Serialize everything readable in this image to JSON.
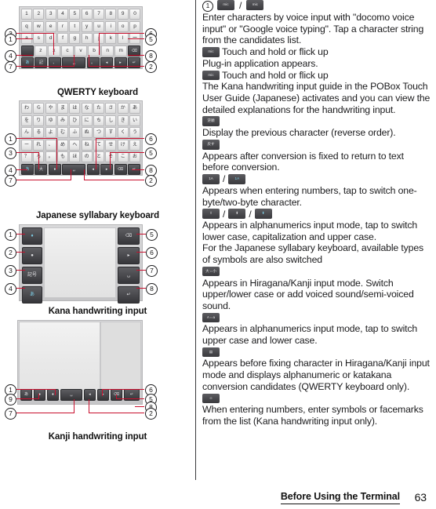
{
  "document": {
    "footer_section": "Before Using the Terminal",
    "page_number": "63"
  },
  "figures": [
    {
      "id": "qwerty-keyboard",
      "caption": "QWERTY keyboard",
      "callouts": [
        "3",
        "1",
        "4",
        "7",
        "6",
        "5",
        "8",
        "2"
      ],
      "rows": [
        [
          "1",
          "2",
          "3",
          "4",
          "5",
          "6",
          "7",
          "8",
          "9",
          "0"
        ],
        [
          "q",
          "w",
          "e",
          "r",
          "t",
          "y",
          "u",
          "i",
          "o",
          "p"
        ],
        [
          "a",
          "s",
          "d",
          "f",
          "g",
          "h",
          "j",
          "k",
          "l",
          "ー"
        ],
        [
          "",
          "z",
          "x",
          "c",
          "v",
          "b",
          "n",
          "m",
          "",
          ""
        ],
        [
          "",
          "",
          "",
          "",
          "",
          "",
          "",
          ""
        ]
      ]
    },
    {
      "id": "japanese-syllabary-keyboard",
      "caption": "Japanese syllabary keyboard",
      "callouts": [
        "1",
        "3",
        "4",
        "7",
        "6",
        "5",
        "8",
        "2"
      ],
      "rows": [
        [
          "わ",
          "ら",
          "や",
          "ま",
          "は",
          "な",
          "た",
          "さ",
          "か",
          "あ"
        ],
        [
          "を",
          "り",
          "ゆ",
          "み",
          "ひ",
          "に",
          "ち",
          "し",
          "き",
          "い"
        ],
        [
          "ん",
          "る",
          "よ",
          "む",
          "ふ",
          "ぬ",
          "つ",
          "す",
          "く",
          "う"
        ],
        [
          "ー",
          "れ",
          "、",
          "め",
          "へ",
          "ね",
          "て",
          "せ",
          "け",
          "え"
        ],
        [
          "？",
          "ろ",
          "。",
          "も",
          "ほ",
          "の",
          "と",
          "そ",
          "こ",
          "お"
        ],
        [
          "",
          "",
          "",
          "",
          "",
          "",
          "",
          ""
        ]
      ]
    },
    {
      "id": "kana-handwriting-input",
      "caption": "Kana handwriting input",
      "callouts_left": [
        "1",
        "2",
        "3",
        "4"
      ],
      "callouts_right": [
        "5",
        "6",
        "7",
        "8"
      ]
    },
    {
      "id": "kanji-handwriting-input",
      "caption": "Kanji handwriting input",
      "callouts": [
        "1",
        "9",
        "7",
        "6",
        "5",
        "8",
        "2"
      ]
    }
  ],
  "content": {
    "item_number": "1",
    "blocks": [
      {
        "type": "icons",
        "icons": [
          "mic",
          "mic"
        ],
        "separators": [
          "/"
        ]
      },
      {
        "type": "text",
        "text": "Enter characters by voice input with \"docomo voice input\" or \"Google voice typing\". Tap a character string from the candidates list."
      },
      {
        "type": "icon_text",
        "icon": "mic",
        "text": "Touch and hold or flick up"
      },
      {
        "type": "text",
        "text": "Plug-in application appears."
      },
      {
        "type": "icon_text",
        "icon": "mic",
        "text": "Touch and hold or flick up"
      },
      {
        "type": "text",
        "text": "The Kana handwriting input guide in the POBox Touch User Guide (Japanese) activates and you can view the detailed explanations for the handwriting input."
      },
      {
        "type": "icons",
        "icons": [
          "逆順"
        ]
      },
      {
        "type": "text",
        "text": "Display the previous character (reverse order)."
      },
      {
        "type": "icons",
        "icons": [
          "戻す"
        ]
      },
      {
        "type": "text",
        "text": "Appears after conversion is fixed to return to text before conversion."
      },
      {
        "type": "icons",
        "icons": [
          "1A",
          "1A"
        ],
        "separators": [
          "/"
        ]
      },
      {
        "type": "text",
        "text": "Appears when entering numbers, tap to switch one-byte/two-byte character."
      },
      {
        "type": "icons",
        "icons": [
          "shift-off",
          "shift-on",
          "shift-lock"
        ],
        "separators": [
          "/",
          "/"
        ]
      },
      {
        "type": "text",
        "text": "Appears in alphanumerics input mode, tap to switch lower case, capitalization and upper case."
      },
      {
        "type": "text",
        "text": "For the Japanese syllabary keyboard, available types of symbols are also switched"
      },
      {
        "type": "icons",
        "icons": [
          "大⇔小"
        ]
      },
      {
        "type": "text",
        "text": "Appears in Hiragana/Kanji input mode. Switch upper/lower case or add voiced sound/semi-voiced sound."
      },
      {
        "type": "icons",
        "icons": [
          "A⇔a"
        ]
      },
      {
        "type": "text",
        "text": "Appears in alphanumerics input mode, tap to switch upper case and lower case."
      },
      {
        "type": "icons",
        "icons": [
          "conv-grid"
        ]
      },
      {
        "type": "text",
        "text": "Appears before fixing character in Hiragana/Kanji input mode and displays alphanumeric or katakana conversion candidates (QWERTY keyboard only)."
      },
      {
        "type": "icons",
        "icons": [
          "face-dot"
        ]
      },
      {
        "type": "text",
        "text": "When entering numbers, enter symbols or facemarks from the list (Kana handwriting input only)."
      }
    ]
  },
  "colors": {
    "leader_line": "#c8102e",
    "key_dark": "#48484c",
    "key_light": "#ececec",
    "accent_blue": "#7fd4ee"
  }
}
